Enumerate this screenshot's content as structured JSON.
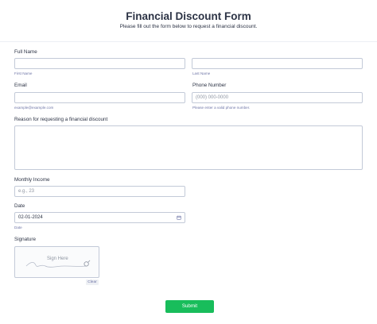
{
  "header": {
    "title": "Financial Discount Form",
    "subtitle": "Please fill out the form below to request a financial discount."
  },
  "full_name": {
    "label": "Full Name",
    "first_sublabel": "First Name",
    "last_sublabel": "Last Name",
    "first_value": "",
    "last_value": ""
  },
  "email": {
    "label": "Email",
    "value": "",
    "sublabel": "example@example.com"
  },
  "phone": {
    "label": "Phone Number",
    "placeholder": "(000) 000-0000",
    "sublabel": "Please enter a valid phone number."
  },
  "reason": {
    "label": "Reason for requesting a financial discount",
    "value": ""
  },
  "income": {
    "label": "Monthly Income",
    "placeholder": "e.g., 23"
  },
  "date": {
    "label": "Date",
    "value": "02-01-2024",
    "sublabel": "Date",
    "icon": "calendar-icon"
  },
  "signature": {
    "label": "Signature",
    "placeholder": "Sign Here",
    "clear_label": "Clear",
    "icon": "pen-icon"
  },
  "submit_label": "Submit",
  "colors": {
    "accent": "#18bd5b",
    "text": "#2c3345",
    "border": "#c3cad8",
    "sublabel": "#6f76a7"
  }
}
